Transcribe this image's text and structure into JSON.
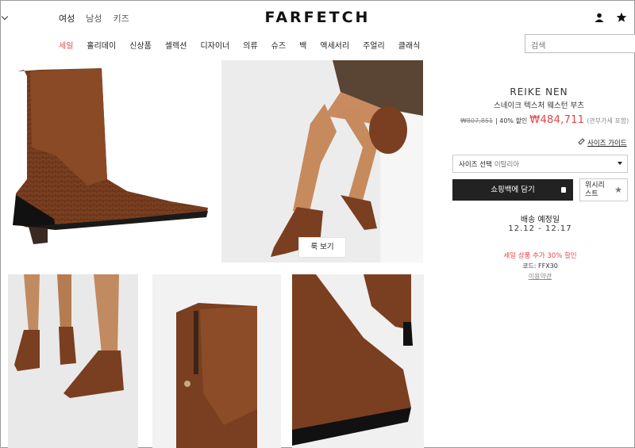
{
  "header": {
    "gender_tabs": [
      "여성",
      "남성",
      "키즈"
    ],
    "logo": "FARFETCH",
    "icons": [
      "user-icon",
      "star-icon"
    ]
  },
  "nav": {
    "items": [
      "세일",
      "홀리데이",
      "신상품",
      "셀렉션",
      "디자이너",
      "의류",
      "슈즈",
      "백",
      "액세서리",
      "주얼리",
      "클래식"
    ],
    "sale_color": "#e54646"
  },
  "search": {
    "placeholder": "검색"
  },
  "gallery": {
    "look_button": "룩 보기"
  },
  "product": {
    "brand": "REIKE NEN",
    "name": "스네이크 텍스처 웨스턴 부츠",
    "original_price": "₩807,851",
    "discount": "| 40% 할인",
    "sale_price": "₩484,711",
    "tax_note": "(관부가세 포함)",
    "size_guide": "사이즈 가이드",
    "size_select_label": "사이즈 선택",
    "size_select_placeholder": "이탈리아",
    "add_to_bag": "쇼핑백에 담기",
    "wishlist_line1": "위시리",
    "wishlist_line2": "스트",
    "shipping_title": "배송 예정일",
    "shipping_dates": "12.12 - 12.17",
    "promo": "세일 상품 추가 30% 할인",
    "code": "코드: FFX30",
    "terms": "이용약관",
    "accent_color": "#e54646"
  }
}
